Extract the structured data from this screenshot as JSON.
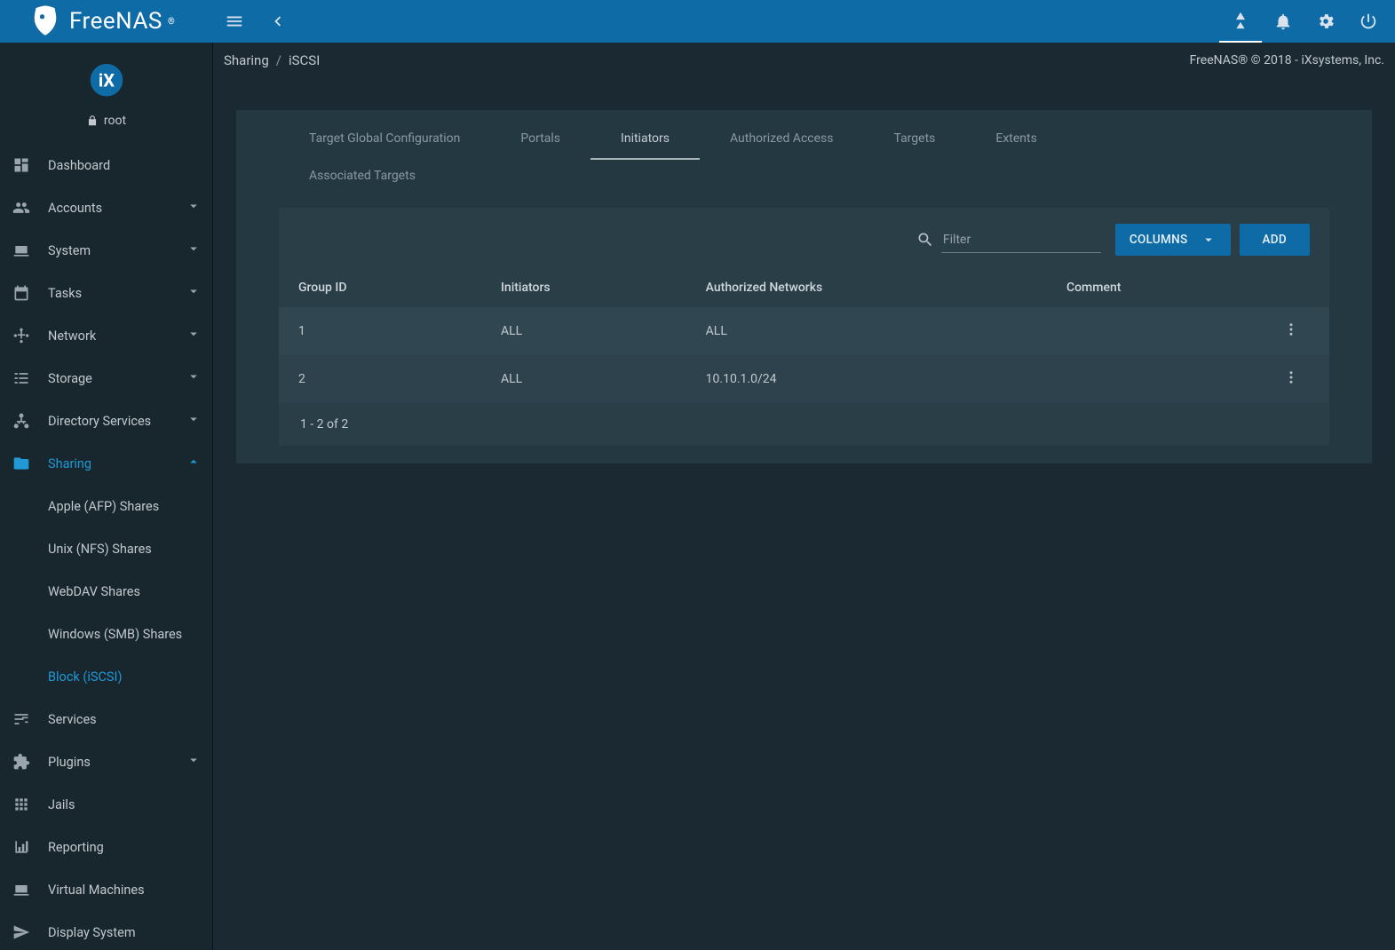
{
  "brand": "FreeNAS",
  "user": "root",
  "breadcrumb": {
    "a": "Sharing",
    "b": "iSCSI"
  },
  "copyright": "FreeNAS® © 2018 - iXsystems, Inc.",
  "nav": {
    "dashboard": "Dashboard",
    "accounts": "Accounts",
    "system": "System",
    "tasks": "Tasks",
    "network": "Network",
    "storage": "Storage",
    "directory": "Directory Services",
    "sharing": "Sharing",
    "services": "Services",
    "plugins": "Plugins",
    "jails": "Jails",
    "reporting": "Reporting",
    "vms": "Virtual Machines",
    "display": "Display System"
  },
  "sharing_sub": {
    "afp": "Apple (AFP) Shares",
    "nfs": "Unix (NFS) Shares",
    "webdav": "WebDAV Shares",
    "smb": "Windows (SMB) Shares",
    "iscsi": "Block (iSCSI)"
  },
  "tabs": {
    "tgc": "Target Global Configuration",
    "portals": "Portals",
    "initiators": "Initiators",
    "auth": "Authorized Access",
    "targets": "Targets",
    "extents": "Extents",
    "assoc": "Associated Targets"
  },
  "toolbar": {
    "filter_placeholder": "Filter",
    "columns": "Columns",
    "add": "Add"
  },
  "table": {
    "headers": {
      "gid": "Group ID",
      "init": "Initiators",
      "net": "Authorized Networks",
      "comment": "Comment"
    },
    "rows": [
      {
        "gid": "1",
        "init": "ALL",
        "net": "ALL",
        "comment": ""
      },
      {
        "gid": "2",
        "init": "ALL",
        "net": "10.10.1.0/24",
        "comment": ""
      }
    ],
    "pager": "1 - 2 of 2"
  }
}
